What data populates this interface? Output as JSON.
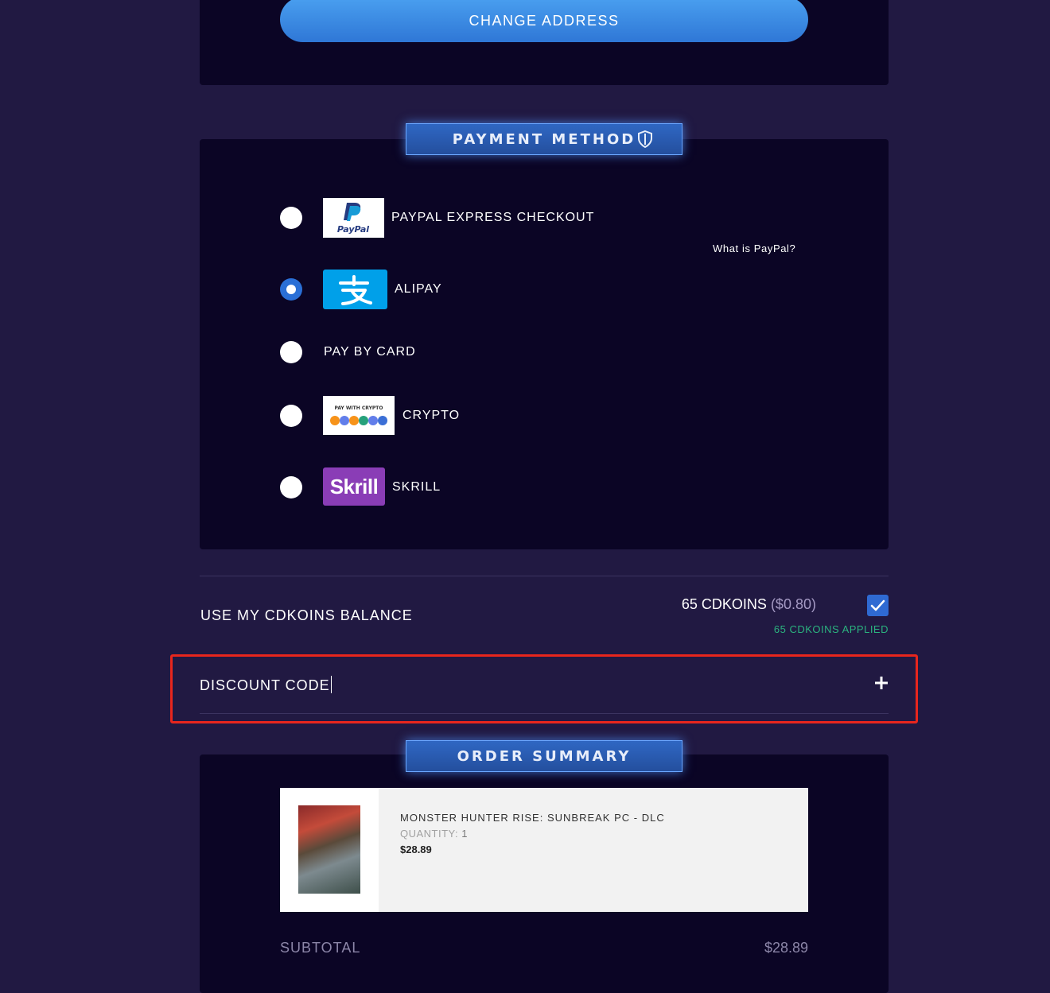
{
  "address": {
    "change_button": "CHANGE ADDRESS"
  },
  "payment": {
    "title": "PAYMENT METHOD",
    "what_is_paypal": "What is PayPal?",
    "methods": [
      {
        "label": "PAYPAL EXPRESS CHECKOUT",
        "logo": "paypal-logo",
        "logo_text": "PayPal",
        "selected": false
      },
      {
        "label": "ALIPAY",
        "logo": "alipay-logo",
        "logo_text": "支",
        "selected": true
      },
      {
        "label": "PAY BY CARD",
        "logo": "",
        "selected": false
      },
      {
        "label": "CRYPTO",
        "logo": "crypto-logo",
        "logo_text": "PAY WITH CRYPTO",
        "selected": false
      },
      {
        "label": "SKRILL",
        "logo": "skrill-logo",
        "logo_text": "Skrill",
        "selected": false
      }
    ]
  },
  "cdkoins": {
    "label": "USE MY CDKOINS BALANCE",
    "amount": "65 CDKOINS",
    "usd": "($0.80)",
    "checked": true,
    "applied": "65 CDKOINS APPLIED"
  },
  "discount": {
    "label": "DISCOUNT CODE",
    "expand_icon": "plus-icon"
  },
  "order": {
    "title": "ORDER SUMMARY",
    "items": [
      {
        "name": "MONSTER HUNTER RISE: SUNBREAK PC - DLC",
        "quantity_label": "QUANTITY:",
        "quantity": "1",
        "price": "$28.89"
      }
    ],
    "subtotal_label": "SUBTOTAL",
    "subtotal_value": "$28.89"
  },
  "colors": {
    "accent": "#2f77d6",
    "panel": "#0b0525",
    "background": "#211942",
    "applied": "#2bb37f",
    "highlight": "#e8261d"
  }
}
